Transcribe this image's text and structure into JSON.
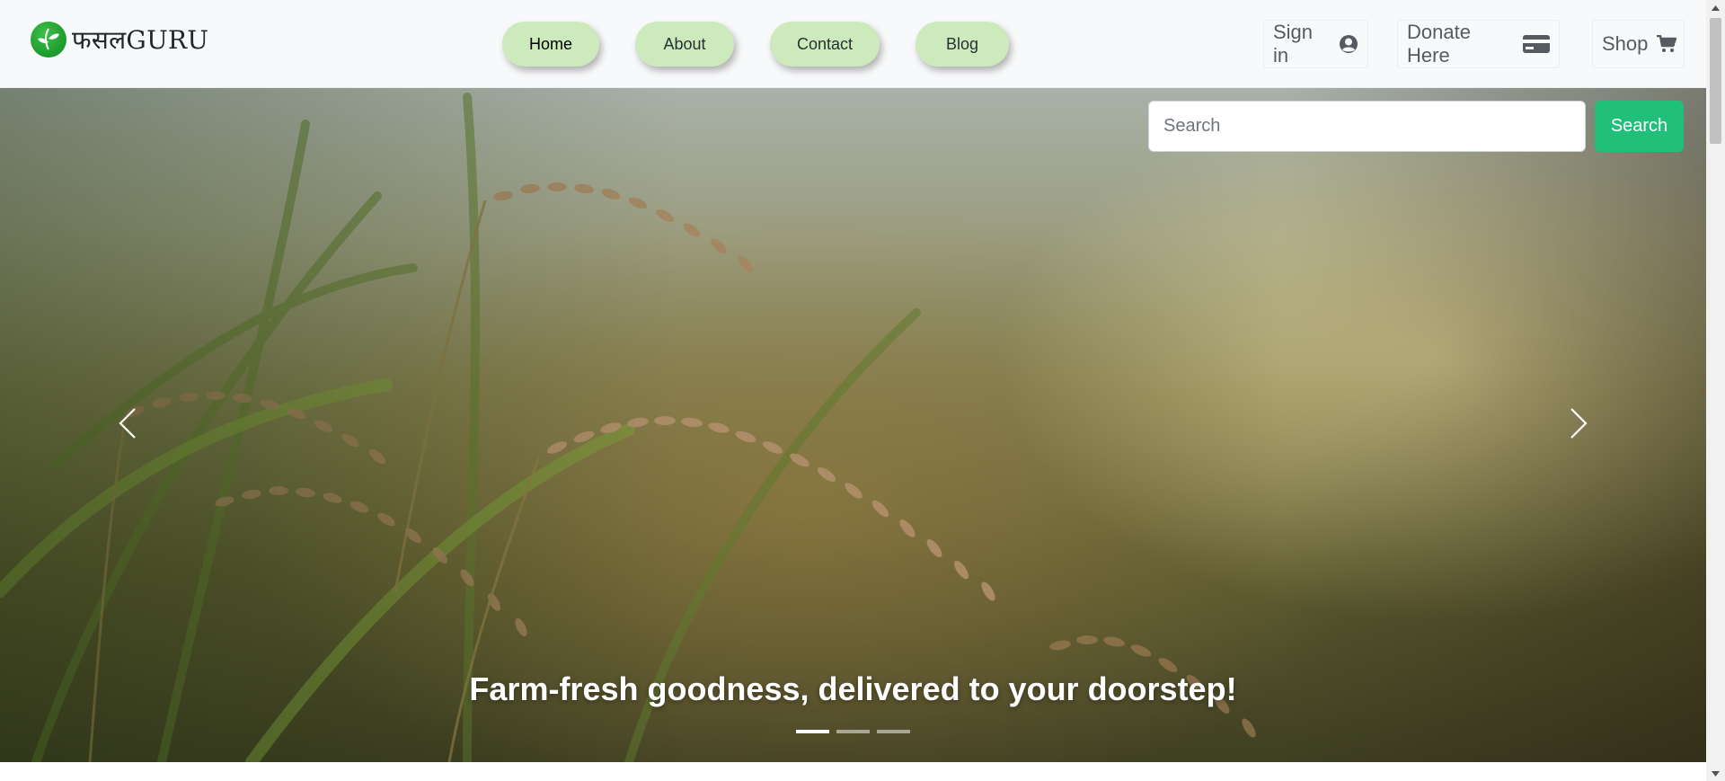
{
  "brand": {
    "name": "फसलGURU",
    "logo_icon": "leaf-globe-icon"
  },
  "nav": {
    "items": [
      {
        "label": "Home",
        "active": true
      },
      {
        "label": "About",
        "active": false
      },
      {
        "label": "Contact",
        "active": false
      },
      {
        "label": "Blog",
        "active": false
      }
    ],
    "pill_color": "#cdeabd"
  },
  "actions": {
    "signin": {
      "label": "Sign in",
      "icon": "user-circle-icon"
    },
    "donate": {
      "label": "Donate Here",
      "icon": "credit-card-icon"
    },
    "shop": {
      "label": "Shop",
      "icon": "shopping-cart-icon"
    }
  },
  "search": {
    "placeholder": "Search",
    "value": "",
    "button_label": "Search",
    "button_color": "#20c07a"
  },
  "carousel": {
    "caption": "Farm-fresh goodness, delivered to your doorstep!",
    "slides": 3,
    "active_index": 0,
    "prev_icon": "chevron-left-icon",
    "next_icon": "chevron-right-icon"
  }
}
